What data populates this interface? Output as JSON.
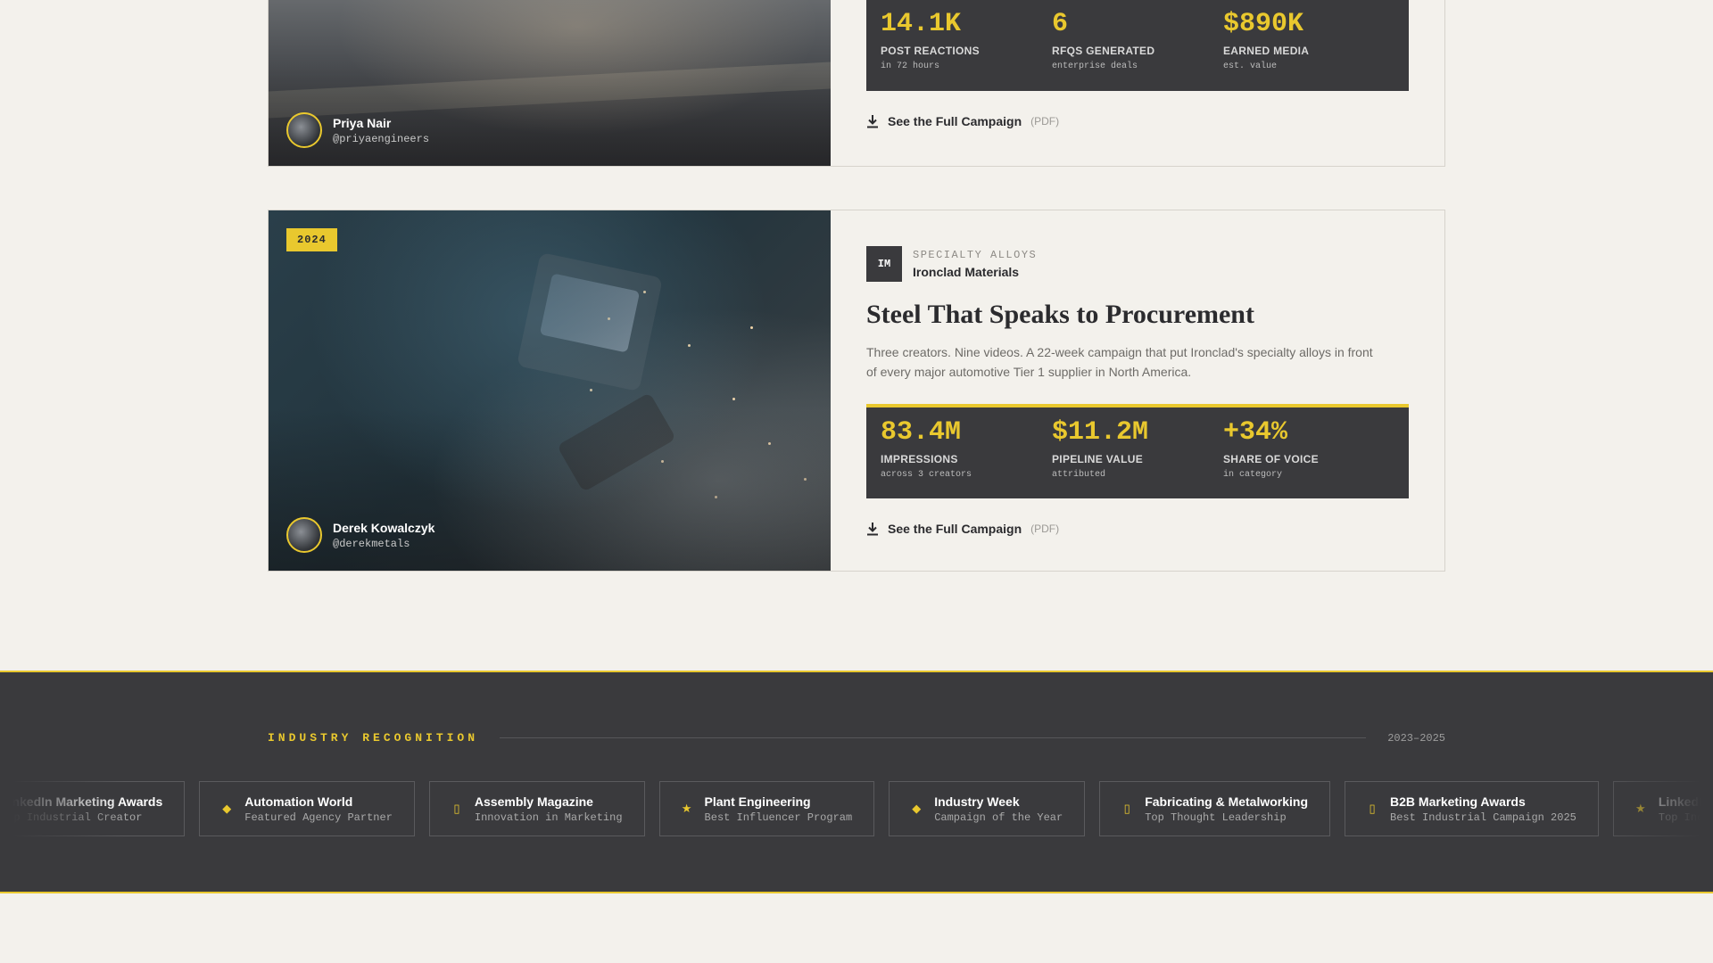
{
  "case_1": {
    "creator_name": "Priya Nair",
    "creator_handle": "@priyaengineers",
    "stats": [
      {
        "value": "14.1K",
        "label": "POST REACTIONS",
        "sub": "in 72 hours"
      },
      {
        "value": "6",
        "label": "RFQS GENERATED",
        "sub": "enterprise deals"
      },
      {
        "value": "$890K",
        "label": "EARNED MEDIA",
        "sub": "est. value"
      }
    ],
    "pdf_label": "See the Full Campaign",
    "pdf_suffix": "(PDF)"
  },
  "case_2": {
    "year": "2024",
    "brand_logo": "IM",
    "brand_category": "SPECIALTY ALLOYS",
    "brand_name": "Ironclad Materials",
    "title": "Steel That Speaks to Procurement",
    "description": "Three creators. Nine videos. A 22-week campaign that put Ironclad's specialty alloys in front of every major automotive Tier 1 supplier in North America.",
    "stats": [
      {
        "value": "83.4M",
        "label": "IMPRESSIONS",
        "sub": "across 3 creators"
      },
      {
        "value": "$11.2M",
        "label": "PIPELINE VALUE",
        "sub": "attributed"
      },
      {
        "value": "+34%",
        "label": "SHARE OF VOICE",
        "sub": "in category"
      }
    ],
    "creator_name": "Derek Kowalczyk",
    "creator_handle": "@derekmetals",
    "pdf_label": "See the Full Campaign",
    "pdf_suffix": "(PDF)"
  },
  "recognition": {
    "title": "INDUSTRY RECOGNITION",
    "years": "2023–2025",
    "awards": [
      {
        "icon": "★",
        "name": "LinkedIn Marketing Awards",
        "sub": "Top Industrial Creator"
      },
      {
        "icon": "◆",
        "name": "Automation World",
        "sub": "Featured Agency Partner"
      },
      {
        "icon": "▯",
        "name": "Assembly Magazine",
        "sub": "Innovation in Marketing"
      },
      {
        "icon": "★",
        "name": "Plant Engineering",
        "sub": "Best Influencer Program"
      },
      {
        "icon": "◆",
        "name": "Industry Week",
        "sub": "Campaign of the Year"
      },
      {
        "icon": "▯",
        "name": "Fabricating & Metalworking",
        "sub": "Top Thought Leadership"
      },
      {
        "icon": "▯",
        "name": "B2B Marketing Awards",
        "sub": "Best Industrial Campaign 2025"
      },
      {
        "icon": "★",
        "name": "LinkedIn Marketing Awards",
        "sub": "Top Industrial Creator"
      }
    ]
  },
  "colors": {
    "accent": "#e9c82e",
    "dark": "#3a3a3d",
    "background": "#f3f1ec"
  }
}
